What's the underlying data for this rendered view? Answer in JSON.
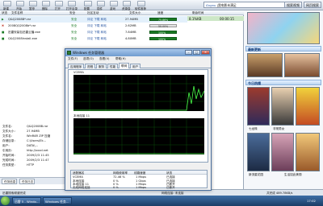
{
  "toolbar": {
    "buttons": [
      {
        "label": "新建",
        "icon": "new-task-icon"
      },
      {
        "label": "开始",
        "icon": "start-icon"
      },
      {
        "label": "暂停",
        "icon": "pause-icon"
      },
      {
        "label": "删除",
        "icon": "delete-icon"
      },
      {
        "label": "打开",
        "icon": "open-icon"
      },
      {
        "label": "打开目录",
        "icon": "folder-icon"
      },
      {
        "label": "配置",
        "icon": "gear-icon"
      },
      {
        "label": "插件",
        "icon": "plugin-icon"
      },
      {
        "label": "游戏",
        "icon": "game-icon"
      },
      {
        "label": "资源盒",
        "icon": "box-icon"
      },
      {
        "label": "软件推荐",
        "icon": "star-icon"
      }
    ],
    "search": {
      "brand": "Gogou",
      "placeholder": "|我电影未满足"
    },
    "right_buttons": [
      "搜索视频",
      "网页搜索"
    ]
  },
  "table": {
    "headers": [
      "状态",
      "文件名称",
      "安全",
      "社区互动",
      "文件大小",
      "速度",
      "剩余时间"
    ],
    "rows": [
      {
        "name": "Q&Q2008B*.rar",
        "safe": "安全",
        "size": "27.94MB",
        "progress": "75.86%",
        "speed": "8.1%KB",
        "time": "00:00:15"
      },
      {
        "name": "2008QQ2008b*.rar",
        "safe": "安全",
        "size": "2.62MB",
        "progress": "50.00%",
        "speed": "",
        "time": ""
      },
      {
        "name": "迅雷安装包迅雷云播.exe",
        "safe": "安全",
        "size": "7.84MB",
        "progress": "100%",
        "speed": "",
        "time": ""
      },
      {
        "name": "Q&Q2008Install.exe",
        "safe": "安全",
        "size": "4.80MB",
        "progress": "100%",
        "speed": "",
        "time": ""
      }
    ]
  },
  "info": {
    "labels": [
      "文件名：",
      "文件大小：",
      "文件名：",
      "存储目录：",
      "用户：",
      "引用页：",
      "开始时间：",
      "完成时间：",
      "任务类型："
    ],
    "values": [
      "Q&Q2008B.rar",
      "27.94MB",
      "WinRAR ZIP 压缩",
      "C:\\Users\\Ek…",
      "DATA\\…",
      "http://xxxd.net",
      "2009/2/3 11:45",
      "2009/2/3 11:47",
      "HTTP"
    ]
  },
  "bottom_tabs": [
    "任务信息",
    "任务日志"
  ],
  "status": {
    "left": "迅雷搜索频道完成",
    "mid": "网络连接: 未连接",
    "right": "共完成 489.78KB/s"
  },
  "taskbar": {
    "buttons": [
      "迅雷 5 - Windo…",
      "Windows 任务…"
    ],
    "time": "17:02"
  },
  "right_panel": {
    "section1": "最新更新",
    "section2": "今日热播",
    "captions": [
      "七龙珠",
      "非常男女",
      "新流星花园",
      "生活如此美丽"
    ]
  },
  "task_manager": {
    "title": "Windows 任务管理器",
    "menu": [
      "文件(F)",
      "选项(O)",
      "查看(V)",
      "帮助(H)"
    ],
    "tabs": [
      "应用程序",
      "进程",
      "服务",
      "性能",
      "联网",
      "用户"
    ],
    "active_tab": "联网",
    "graph1_label": "VCEMA",
    "graph2_label": "本地连接 11",
    "net_headers": [
      "适配器名",
      "网络使用率",
      "线路速度",
      "状态"
    ],
    "net_rows": [
      {
        "name": "VCEMA",
        "usage": "72.46 %",
        "speed": "1 Mbps",
        "state": "已连接"
      },
      {
        "name": "本地连接",
        "usage": "0 %",
        "speed": "1 Gbps",
        "state": "已连接"
      },
      {
        "name": "本地连接 11",
        "usage": "0 %",
        "speed": "1 Mbps",
        "state": "已断开"
      },
      {
        "name": "无线网络连接",
        "usage": "0 %",
        "speed": "1 Mbps",
        "state": "已断开"
      }
    ]
  },
  "colors": {
    "accent": "#1a7a24",
    "selected": "#cde7c7",
    "titlebar": "#6f9ccf"
  }
}
